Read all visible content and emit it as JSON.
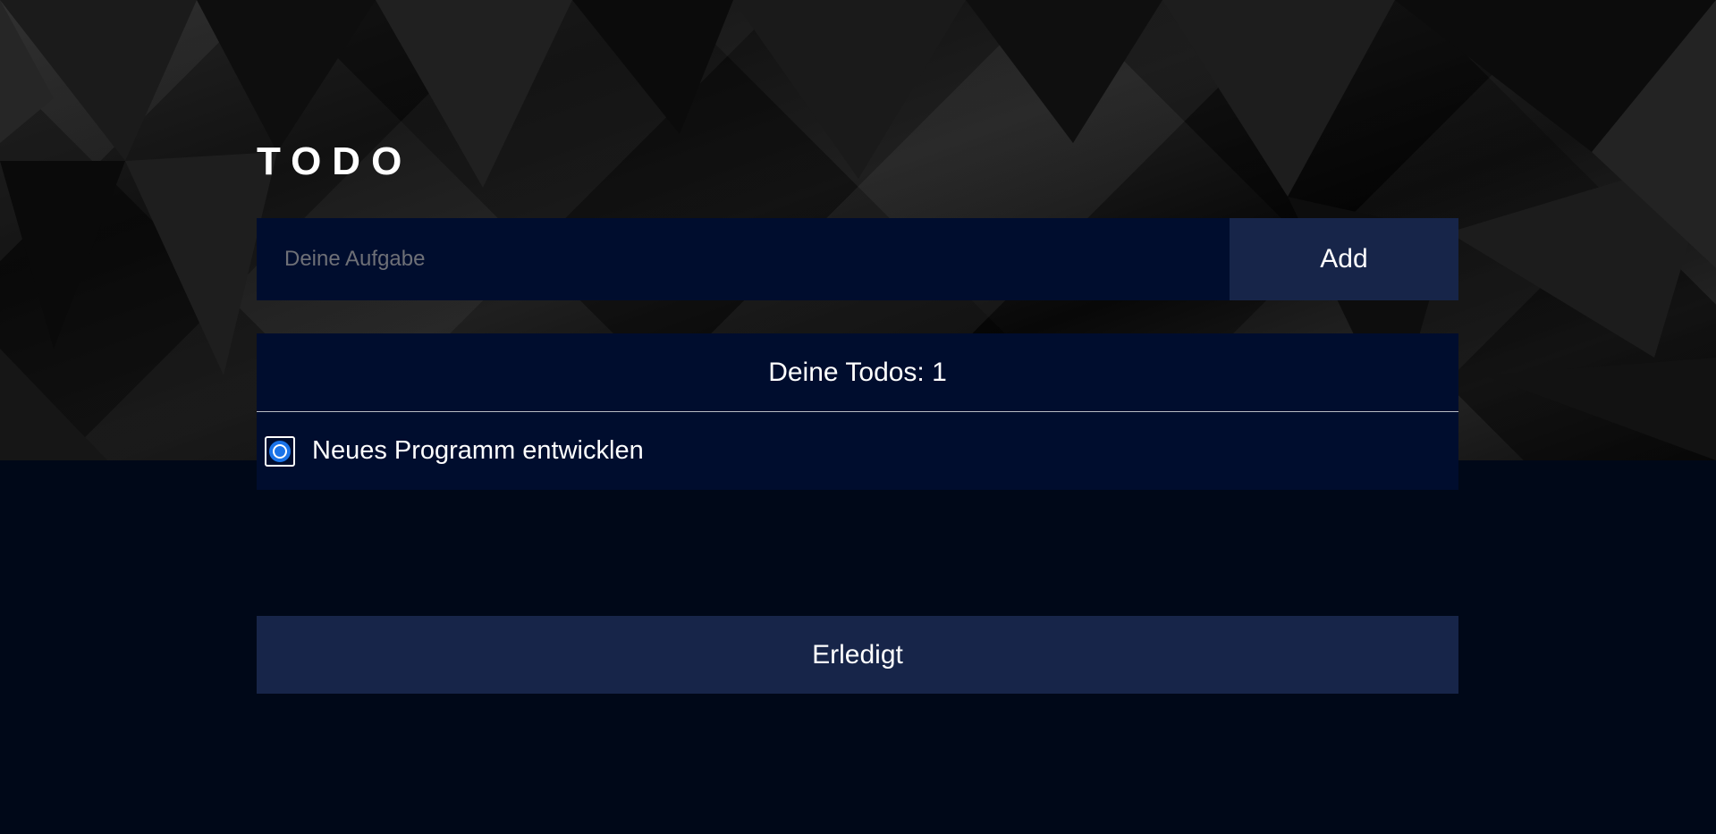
{
  "app": {
    "title": "TODO"
  },
  "input": {
    "placeholder": "Deine Aufgabe",
    "value": "",
    "add_label": "Add"
  },
  "todos": {
    "header": "Deine Todos: 1",
    "items": [
      {
        "label": "Neues Programm entwicklen",
        "checked": true
      }
    ]
  },
  "actions": {
    "done_label": "Erledigt"
  },
  "colors": {
    "panel_bg": "#000d2e",
    "button_bg": "#172549",
    "page_bg": "#000818",
    "radio_accent": "#1a73e8"
  },
  "icons": {
    "todo_item_marker": "radio-selected-icon"
  }
}
